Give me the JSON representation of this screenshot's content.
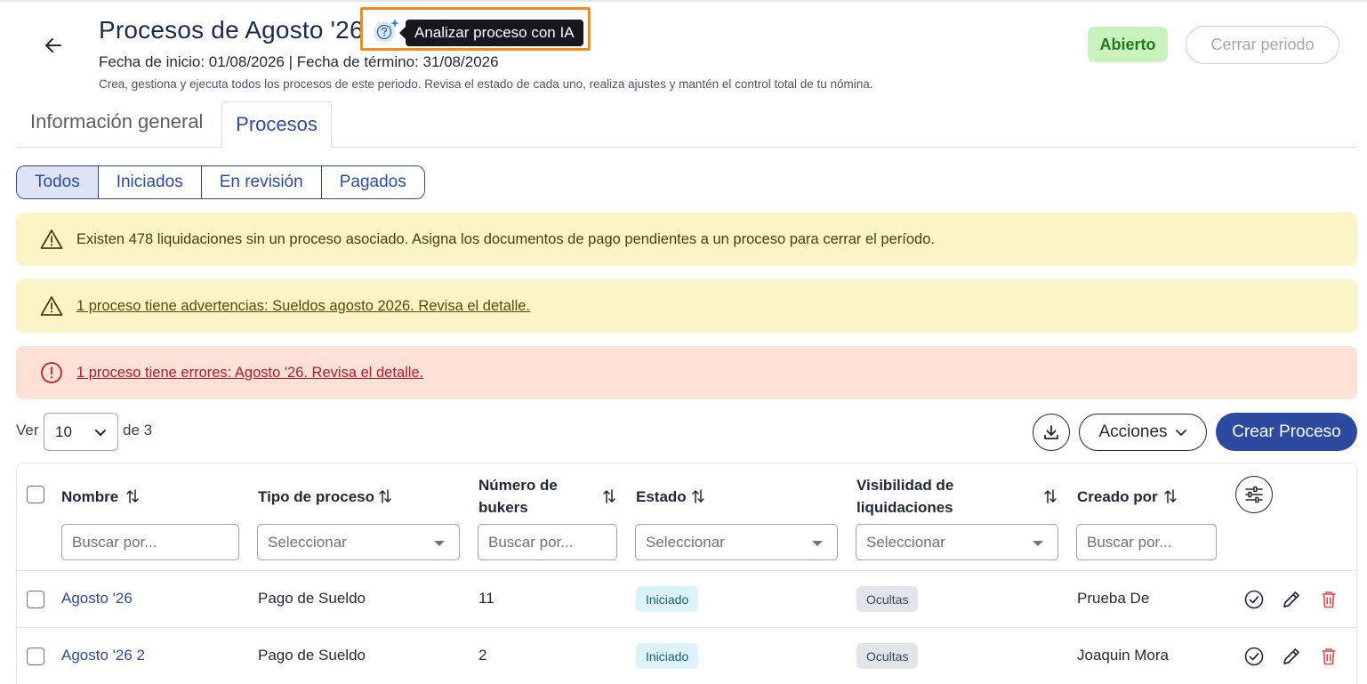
{
  "header": {
    "title": "Procesos de Agosto '26",
    "ai_tooltip": "Analizar proceso con IA",
    "dates": "Fecha de inicio: 01/08/2026  | Fecha de término: 31/08/2026",
    "description": "Crea, gestiona y ejecuta todos los procesos de este periodo. Revisa el estado de cada uno, realiza ajustes y mantén el control total de tu nómina.",
    "status": "Abierto",
    "close_label": "Cerrar periodo"
  },
  "tabs": [
    {
      "label": "Información general"
    },
    {
      "label": "Procesos"
    }
  ],
  "filters": [
    {
      "label": "Todos"
    },
    {
      "label": "Iniciados"
    },
    {
      "label": "En revisión"
    },
    {
      "label": "Pagados"
    }
  ],
  "alerts": {
    "warning1": "Existen 478 liquidaciones sin un proceso asociado. Asigna los documentos de pago pendientes a un proceso para cerrar el período.",
    "warning2": "1 proceso tiene advertencias: Sueldos agosto 2026. Revisa el detalle.",
    "error": "1 proceso tiene errores: Agosto '26. Revisa el detalle."
  },
  "pagination": {
    "ver_label": "Ver",
    "page_size": "10",
    "of_label": "de 3"
  },
  "toolbar": {
    "actions_label": "Acciones",
    "create_label": "Crear Proceso"
  },
  "table": {
    "headers": {
      "name": "Nombre",
      "type": "Tipo de proceso",
      "bukers_line1": "Número de",
      "bukers_line2": "bukers",
      "status": "Estado",
      "visibility_line1": "Visibilidad de",
      "visibility_line2": "liquidaciones",
      "creator": "Creado por"
    },
    "filters": {
      "name_placeholder": "Buscar por...",
      "type_placeholder": "Seleccionar",
      "bukers_placeholder": "Buscar por...",
      "status_placeholder": "Seleccionar",
      "visibility_placeholder": "Seleccionar",
      "creator_placeholder": "Buscar por..."
    },
    "rows": [
      {
        "name": "Agosto '26",
        "type": "Pago de Sueldo",
        "bukers": "11",
        "status": "Iniciado",
        "visibility": "Ocultas",
        "creator": "Prueba De"
      },
      {
        "name": "Agosto '26 2",
        "type": "Pago de Sueldo",
        "bukers": "2",
        "status": "Iniciado",
        "visibility": "Ocultas",
        "creator": "Joaquin Mora"
      }
    ]
  },
  "colors": {
    "primary": "#2b4aa0",
    "highlight": "#f28a1c",
    "open_bg": "#c9f2bd",
    "warning_bg": "#fbf4c7",
    "error_bg": "#fde0d6",
    "delete": "#e0474c"
  }
}
